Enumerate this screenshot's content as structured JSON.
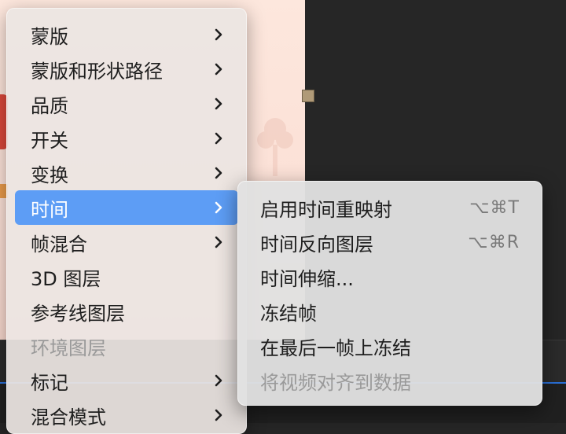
{
  "menu": {
    "items": [
      {
        "label": "蒙版",
        "submenu": true
      },
      {
        "label": "蒙版和形状路径",
        "submenu": true
      },
      {
        "label": "品质",
        "submenu": true
      },
      {
        "label": "开关",
        "submenu": true
      },
      {
        "label": "变换",
        "submenu": true
      },
      {
        "label": "时间",
        "submenu": true,
        "selected": true
      },
      {
        "label": "帧混合",
        "submenu": true
      },
      {
        "label": "3D 图层",
        "submenu": false
      },
      {
        "label": "参考线图层",
        "submenu": false
      },
      {
        "label": "环境图层",
        "submenu": false,
        "disabled": true
      },
      {
        "label": "标记",
        "submenu": true
      },
      {
        "label": "混合模式",
        "submenu": true
      }
    ]
  },
  "submenu": {
    "items": [
      {
        "label": "启用时间重映射",
        "shortcut": "⌥⌘T"
      },
      {
        "label": "时间反向图层",
        "shortcut": "⌥⌘R"
      },
      {
        "label": "时间伸缩...",
        "shortcut": ""
      },
      {
        "label": "冻结帧",
        "shortcut": ""
      },
      {
        "label": "在最后一帧上冻结",
        "shortcut": ""
      },
      {
        "label": "将视频对齐到数据",
        "shortcut": "",
        "disabled": true
      }
    ]
  },
  "colors": {
    "selection": "#5d9df5",
    "disabled_text": "#9a9a9a"
  }
}
